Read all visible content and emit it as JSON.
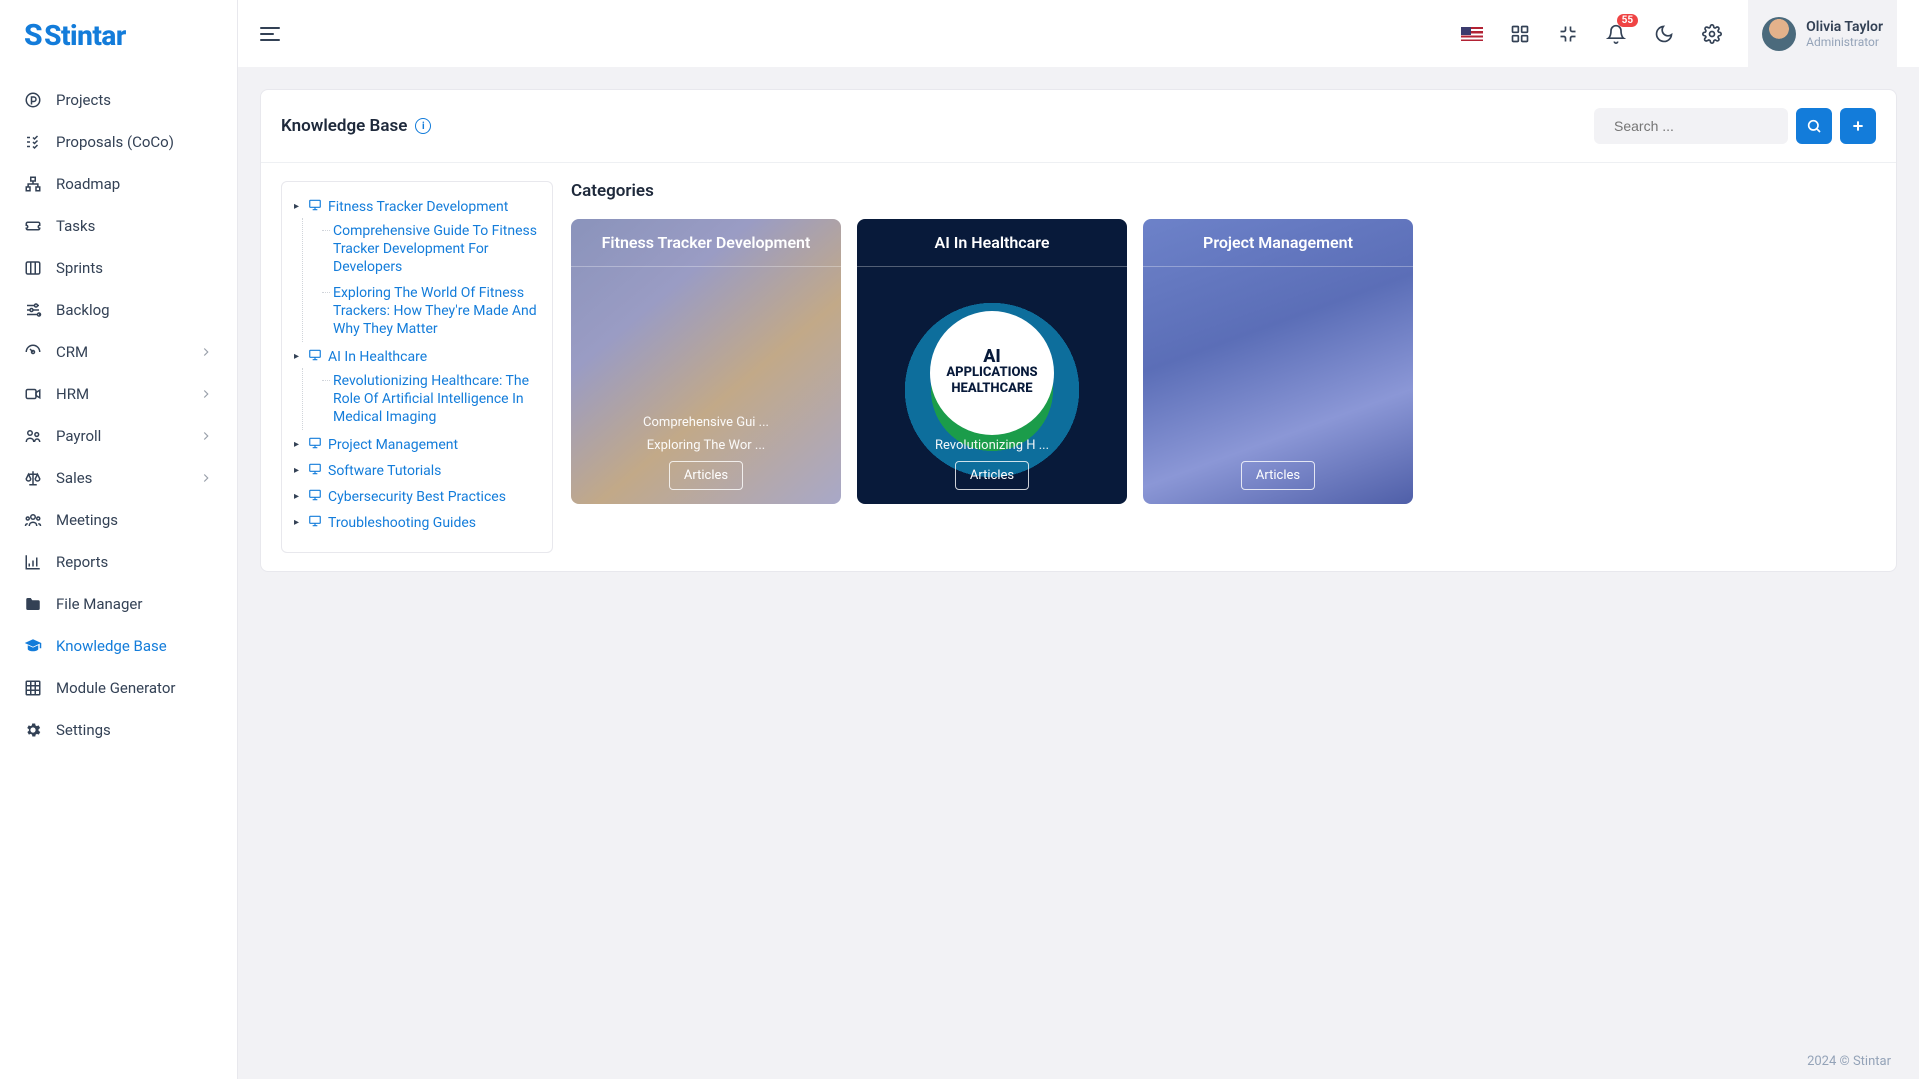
{
  "brand": "Stintar",
  "user": {
    "name": "Olivia Taylor",
    "role": "Administrator"
  },
  "notification_count": "55",
  "sidebar": {
    "items": [
      {
        "label": "Projects",
        "icon": "p-circle"
      },
      {
        "label": "Proposals (CoCo)",
        "icon": "task-list"
      },
      {
        "label": "Roadmap",
        "icon": "sitemap"
      },
      {
        "label": "Tasks",
        "icon": "ticket"
      },
      {
        "label": "Sprints",
        "icon": "columns"
      },
      {
        "label": "Backlog",
        "icon": "sliders"
      },
      {
        "label": "CRM",
        "icon": "gauge",
        "expandable": true
      },
      {
        "label": "HRM",
        "icon": "video",
        "expandable": true
      },
      {
        "label": "Payroll",
        "icon": "people",
        "expandable": true
      },
      {
        "label": "Sales",
        "icon": "scale",
        "expandable": true
      },
      {
        "label": "Meetings",
        "icon": "group"
      },
      {
        "label": "Reports",
        "icon": "chart"
      },
      {
        "label": "File Manager",
        "icon": "folder"
      },
      {
        "label": "Knowledge Base",
        "icon": "grad-cap",
        "active": true
      },
      {
        "label": "Module Generator",
        "icon": "grid"
      },
      {
        "label": "Settings",
        "icon": "gear"
      }
    ]
  },
  "page": {
    "title": "Knowledge Base",
    "search_placeholder": "Search ...",
    "categories_heading": "Categories"
  },
  "tree": [
    {
      "label": "Fitness Tracker Development",
      "children": [
        "Comprehensive Guide To Fitness Tracker Development For Developers",
        "Exploring The World Of Fitness Trackers: How They're Made And Why They Matter"
      ]
    },
    {
      "label": "AI In Healthcare",
      "children": [
        "Revolutionizing Healthcare: The Role Of Artificial Intelligence In Medical Imaging"
      ]
    },
    {
      "label": "Project Management"
    },
    {
      "label": "Software Tutorials"
    },
    {
      "label": "Cybersecurity Best Practices"
    },
    {
      "label": "Troubleshooting Guides"
    }
  ],
  "categories": [
    {
      "title": "Fitness Tracker Development",
      "articles": [
        "Comprehensive Gui ...",
        "Exploring The Wor ..."
      ],
      "button": "Articles"
    },
    {
      "title": "AI In Healthcare",
      "center_big": "AI",
      "center_l2": "APPLICATIONS",
      "center_l3": "HEALTHCARE",
      "articles": [
        "Revolutionizing H ..."
      ],
      "button": "Articles"
    },
    {
      "title": "Project Management",
      "articles": [],
      "button": "Articles"
    }
  ],
  "footer": "2024 © Stintar"
}
